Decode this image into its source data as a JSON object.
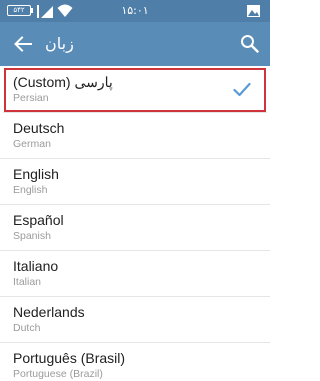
{
  "status_bar": {
    "battery": "۵۴۲",
    "clock": "۱۵:۰۱",
    "icons": [
      "battery-icon",
      "signal-icon",
      "wifi-icon",
      "gallery-icon"
    ]
  },
  "action_bar": {
    "title": "زبان",
    "back_icon": "arrow-left-icon",
    "search_icon": "search-icon"
  },
  "languages": [
    {
      "name": "(Custom) پارسی",
      "subtitle": "Persian",
      "selected": true
    },
    {
      "name": "Deutsch",
      "subtitle": "German",
      "selected": false
    },
    {
      "name": "English",
      "subtitle": "English",
      "selected": false
    },
    {
      "name": "Español",
      "subtitle": "Spanish",
      "selected": false
    },
    {
      "name": "Italiano",
      "subtitle": "Italian",
      "selected": false
    },
    {
      "name": "Nederlands",
      "subtitle": "Dutch",
      "selected": false
    },
    {
      "name": "Português (Brasil)",
      "subtitle": "Portuguese (Brazil)",
      "selected": false
    }
  ],
  "colors": {
    "status_bar": "#4f7fa8",
    "action_bar": "#5a8cb8",
    "check": "#5a9bd5",
    "selection_outline": "#d0343b"
  }
}
